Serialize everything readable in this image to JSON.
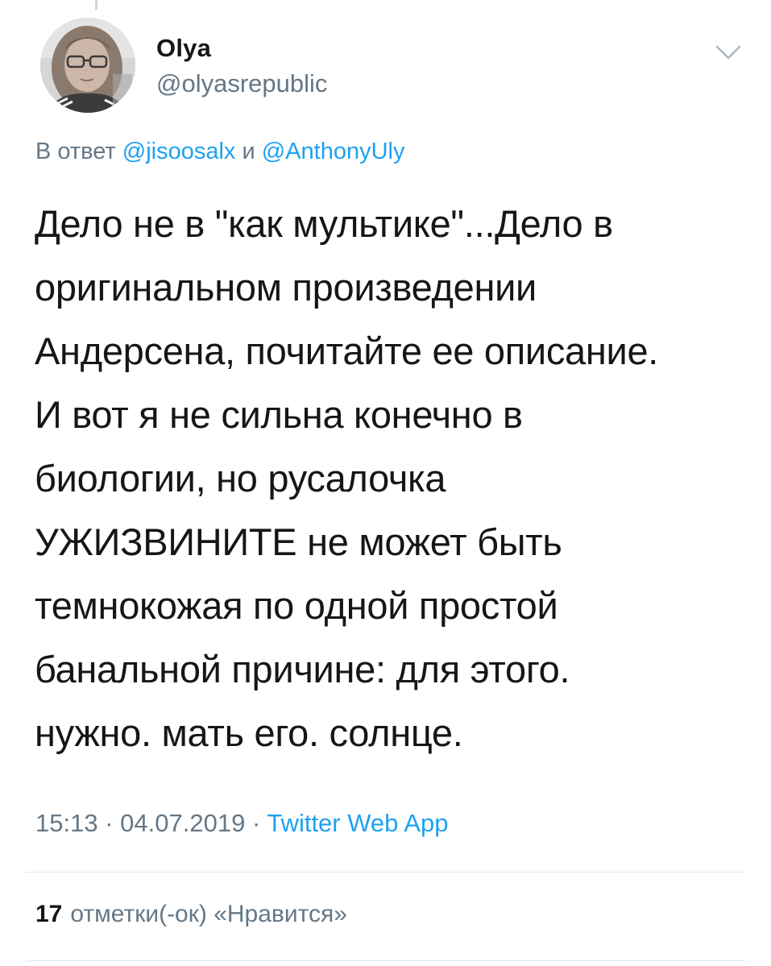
{
  "tweet": {
    "author": {
      "display_name": "Olya",
      "handle": "@olyasrepublic"
    },
    "reply": {
      "prefix": "В ответ",
      "mention_1": "@jisoosalx",
      "joiner": "и",
      "mention_2": "@AnthonyUly"
    },
    "text": "Дело не в \"как мультике\"...Дело в\nоригинальном произведении\nАндерсена, почитайте ее описание.\nИ вот я не сильна конечно в\nбиологии, но русалочка\nУЖИЗВИНИТЕ не может быть\nтемнокожая по одной простой\nбанальной причине: для этого.\nнужно. мать его. солнце.",
    "time": "15:13",
    "date": "04.07.2019",
    "separator": "·",
    "source": "Twitter Web App",
    "likes": {
      "count": "17",
      "label": "отметки(-ок) «Нравится»"
    }
  },
  "icons": {
    "menu": "chevron-down-icon"
  },
  "colors": {
    "text": "#14171a",
    "secondary": "#657786",
    "link": "#1da1f2",
    "divider": "#e1e8ed"
  }
}
